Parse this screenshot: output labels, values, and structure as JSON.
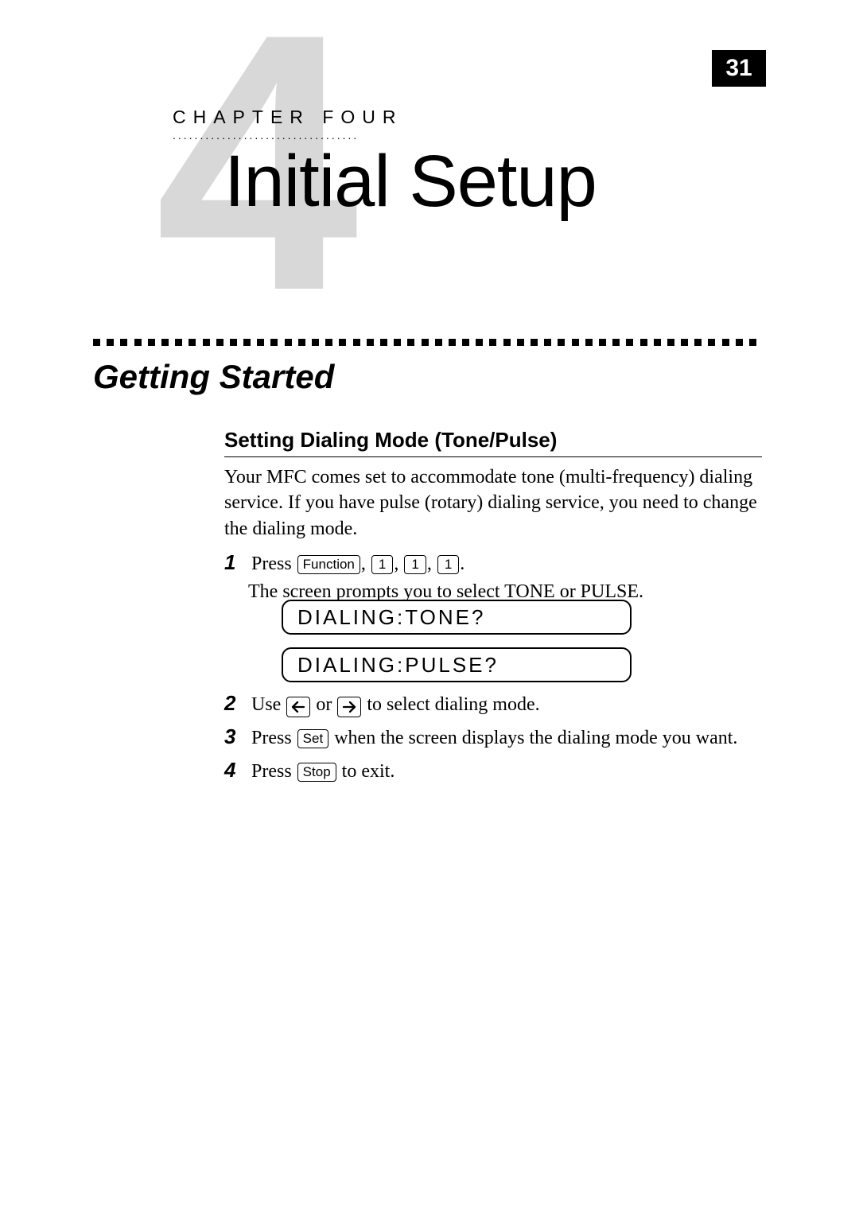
{
  "page_number": "31",
  "chapter": {
    "big_number": "4",
    "label": "CHAPTER FOUR",
    "dots": "..................................",
    "title": "Initial Setup"
  },
  "section": {
    "title": "Getting Started"
  },
  "subsection": {
    "title": "Setting Dialing Mode (Tone/Pulse)",
    "intro": "Your MFC comes set to accommodate tone (multi-frequency) dialing service. If you have pulse (rotary) dialing service, you need to change the dialing mode."
  },
  "steps": {
    "s1": {
      "num": "1",
      "press_word": "Press ",
      "key_function": "Function",
      "key_1a": "1",
      "key_1b": "1",
      "key_1c": "1",
      "period": ".",
      "line2": "The screen prompts you to select TONE or PULSE."
    },
    "lcd1": "DIALING:TONE?",
    "lcd2": "DIALING:PULSE?",
    "s2": {
      "num": "2",
      "pre": "Use ",
      "mid": " or ",
      "post": " to select dialing mode."
    },
    "s3": {
      "num": "3",
      "pre": "Press ",
      "key_set": "Set",
      "post": " when the screen displays the dialing mode you want."
    },
    "s4": {
      "num": "4",
      "pre": "Press ",
      "key_stop": "Stop",
      "post": " to exit."
    }
  }
}
